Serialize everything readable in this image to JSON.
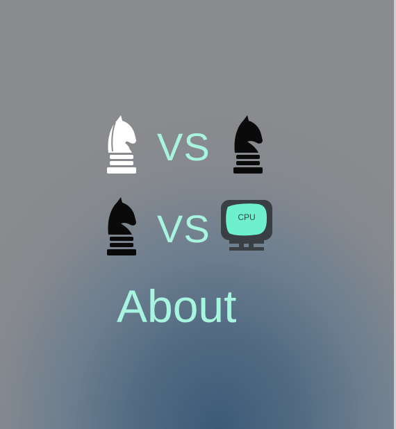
{
  "menu": {
    "pvp": {
      "left_piece": "white-knight-icon",
      "vs_label": "VS",
      "right_piece": "black-knight-icon"
    },
    "pvc": {
      "left_piece": "black-knight-icon",
      "vs_label": "VS",
      "right_icon": "cpu-monitor-icon",
      "cpu_label": "CPU"
    },
    "about_label": "About"
  },
  "colors": {
    "accent": "#a8f5df",
    "cpu_screen": "#6ef0cf",
    "cpu_frame": "#3a3f44"
  }
}
